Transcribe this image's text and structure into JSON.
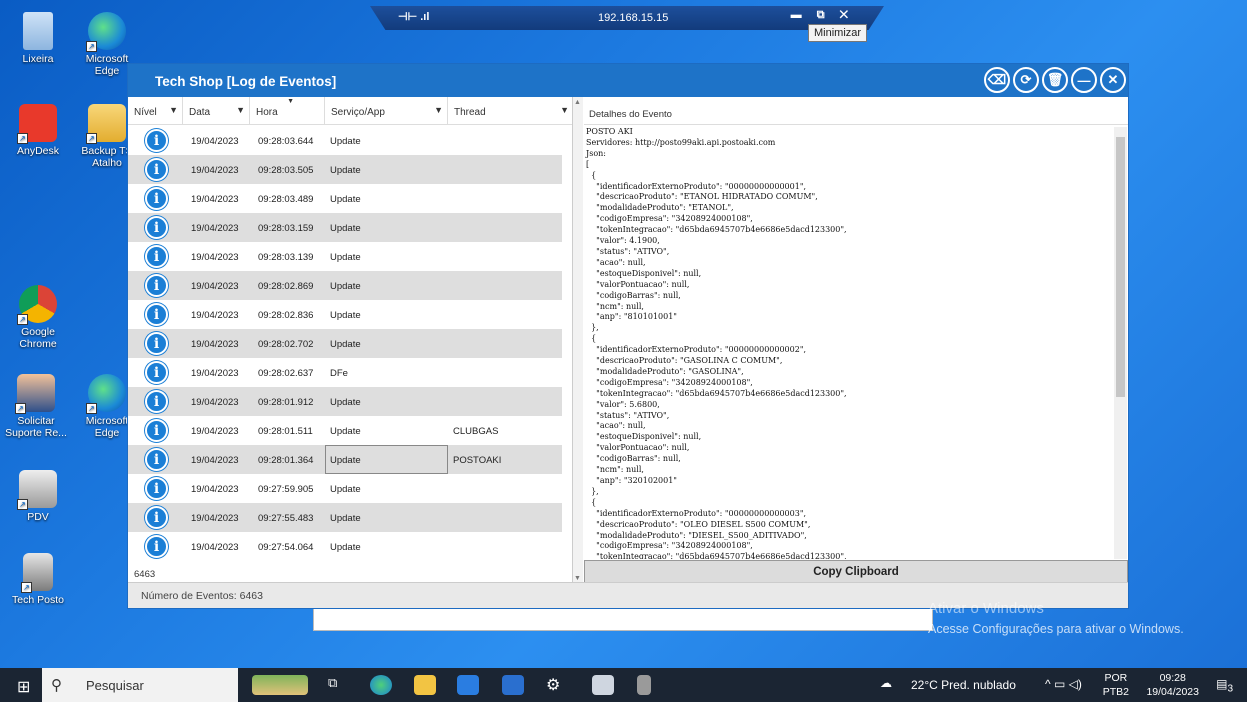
{
  "desktop": {
    "icons": [
      {
        "label": "Lixeira"
      },
      {
        "label": "Microsoft Edge"
      },
      {
        "label": "AnyDesk"
      },
      {
        "label": "Backup TS Atalho"
      },
      {
        "label": "Google Chrome"
      },
      {
        "label": "Solicitar Suporte Re..."
      },
      {
        "label": "Microsoft Edge"
      },
      {
        "label": "PDV"
      },
      {
        "label": "Tech Posto"
      }
    ]
  },
  "remote_bar": {
    "ip": "192.168.15.15",
    "tooltip": "Minimizar"
  },
  "app": {
    "title": "Tech Shop [Log de Eventos]",
    "columns": {
      "nivel": "Nível",
      "data": "Data",
      "hora": "Hora",
      "servico": "Serviço/App",
      "thread": "Thread"
    },
    "rows": [
      {
        "date": "19/04/2023",
        "time": "09:28:03.644",
        "service": "Update",
        "thread": ""
      },
      {
        "date": "19/04/2023",
        "time": "09:28:03.505",
        "service": "Update",
        "thread": ""
      },
      {
        "date": "19/04/2023",
        "time": "09:28:03.489",
        "service": "Update",
        "thread": ""
      },
      {
        "date": "19/04/2023",
        "time": "09:28:03.159",
        "service": "Update",
        "thread": ""
      },
      {
        "date": "19/04/2023",
        "time": "09:28:03.139",
        "service": "Update",
        "thread": ""
      },
      {
        "date": "19/04/2023",
        "time": "09:28:02.869",
        "service": "Update",
        "thread": ""
      },
      {
        "date": "19/04/2023",
        "time": "09:28:02.836",
        "service": "Update",
        "thread": ""
      },
      {
        "date": "19/04/2023",
        "time": "09:28:02.702",
        "service": "Update",
        "thread": ""
      },
      {
        "date": "19/04/2023",
        "time": "09:28:02.637",
        "service": "DFe",
        "thread": ""
      },
      {
        "date": "19/04/2023",
        "time": "09:28:01.912",
        "service": "Update",
        "thread": ""
      },
      {
        "date": "19/04/2023",
        "time": "09:28:01.511",
        "service": "Update",
        "thread": "CLUBGAS"
      },
      {
        "date": "19/04/2023",
        "time": "09:28:01.364",
        "service": "Update",
        "thread": "POSTOAKI"
      },
      {
        "date": "19/04/2023",
        "time": "09:27:59.905",
        "service": "Update",
        "thread": ""
      },
      {
        "date": "19/04/2023",
        "time": "09:27:55.483",
        "service": "Update",
        "thread": ""
      },
      {
        "date": "19/04/2023",
        "time": "09:27:54.064",
        "service": "Update",
        "thread": ""
      }
    ],
    "row_count": "6463",
    "status": "Número de Eventos: 6463",
    "details_header": "Detalhes do Evento",
    "details_text": "POSTO AKI\nServidores: http://posto99aki.api.postoaki.com\nJson:\n[\n  {\n    \"identificadorExternoProduto\": \"00000000000001\",\n    \"descricaoProduto\": \"ETANOL HIDRATADO COMUM\",\n    \"modalidadeProduto\": \"ETANOL\",\n    \"codigoEmpresa\": \"34208924000108\",\n    \"tokenIntegracao\": \"d65bda6945707b4e6686e5dacd123300\",\n    \"valor\": 4.1900,\n    \"status\": \"ATIVO\",\n    \"acao\": null,\n    \"estoqueDisponivel\": null,\n    \"valorPontuacao\": null,\n    \"codigoBarras\": null,\n    \"ncm\": null,\n    \"anp\": \"810101001\"\n  },\n  {\n    \"identificadorExternoProduto\": \"00000000000002\",\n    \"descricaoProduto\": \"GASOLINA C COMUM\",\n    \"modalidadeProduto\": \"GASOLINA\",\n    \"codigoEmpresa\": \"34208924000108\",\n    \"tokenIntegracao\": \"d65bda6945707b4e6686e5dacd123300\",\n    \"valor\": 5.6800,\n    \"status\": \"ATIVO\",\n    \"acao\": null,\n    \"estoqueDisponivel\": null,\n    \"valorPontuacao\": null,\n    \"codigoBarras\": null,\n    \"ncm\": null,\n    \"anp\": \"320102001\"\n  },\n  {\n    \"identificadorExternoProduto\": \"00000000000003\",\n    \"descricaoProduto\": \"OLEO DIESEL S500 COMUM\",\n    \"modalidadeProduto\": \"DIESEL_S500_ADITIVADO\",\n    \"codigoEmpresa\": \"34208924000108\",\n    \"tokenIntegracao\": \"d65bda6945707b4e6686e5dacd123300\",",
    "copy_button": "Copy Clipboard"
  },
  "watermark": {
    "line1": "Ativar o Windows",
    "line2": "Acesse Configurações para ativar o Windows."
  },
  "taskbar": {
    "search": "Pesquisar",
    "weather": "22°C  Pred. nublado",
    "lang1": "POR",
    "lang2": "PTB2",
    "time": "09:28",
    "date": "19/04/2023",
    "notifications": "3"
  },
  "colors": {
    "titlebar": "#1e73c8",
    "info_icon": "#1b7fd6",
    "row_alt": "#dedede"
  }
}
